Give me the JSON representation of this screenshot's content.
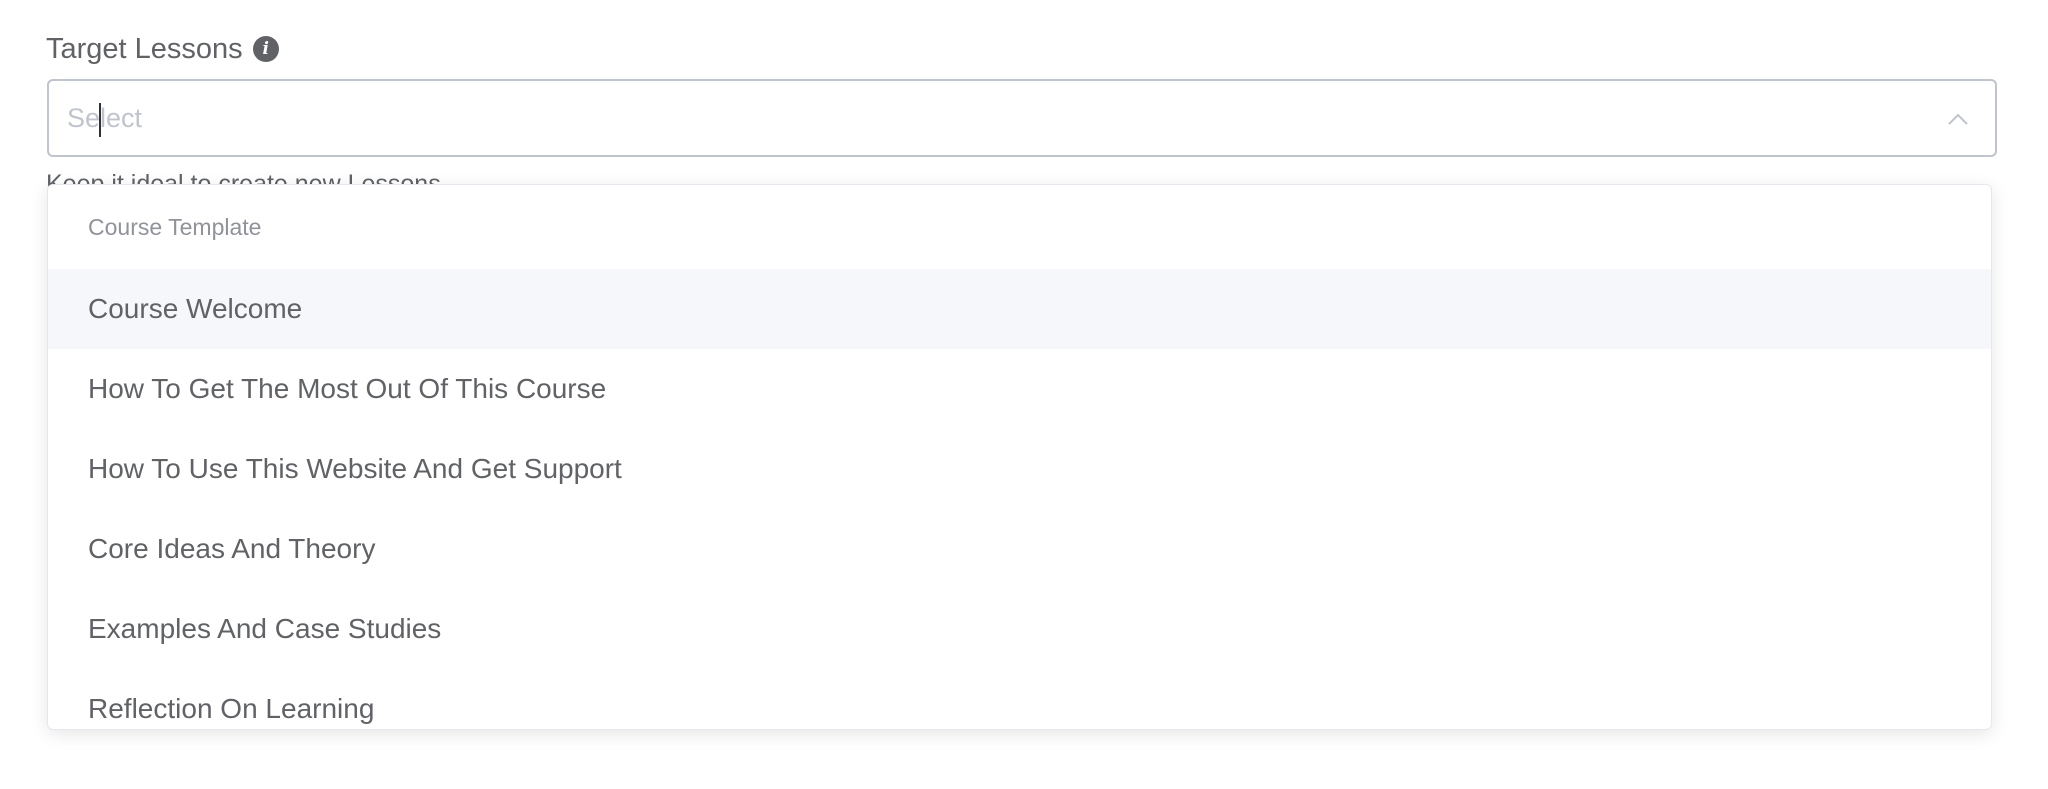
{
  "field": {
    "label": "Target Lessons",
    "info_icon": "info-icon"
  },
  "select": {
    "placeholder_part1": "Se",
    "placeholder_part2": "lect",
    "expand_icon": "chevron-up-icon"
  },
  "hint": "Keep it ideal to create new Lessons",
  "dropdown": {
    "group_title": "Course Template",
    "options": [
      "Course Welcome",
      "How To Get The Most Out Of This Course",
      "How To Use This Website And Get Support",
      "Core Ideas And Theory",
      "Examples And Case Studies",
      "Reflection On Learning"
    ],
    "hovered_option": "Course Welcome"
  },
  "colors": {
    "text": "#606266",
    "placeholder": "#c0c4cc",
    "border": "#c0c4cc",
    "hover_bg": "#f5f7fa",
    "group_title": "#909399"
  }
}
